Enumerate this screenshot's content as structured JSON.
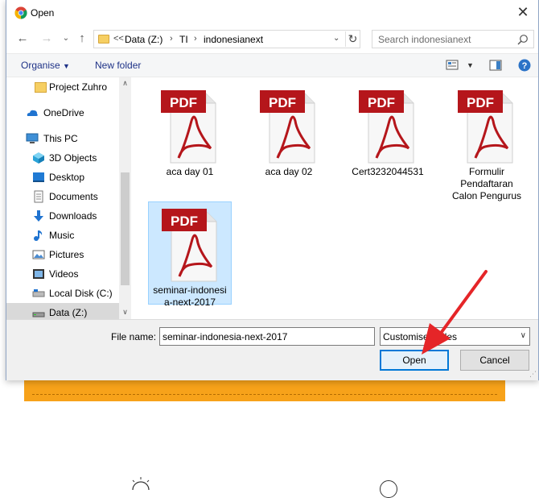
{
  "window": {
    "title": "Open"
  },
  "nav": {
    "breadcrumb": [
      "Data (Z:)",
      "TI",
      "indonesianext"
    ],
    "overflow": "<<",
    "search_placeholder": "Search indonesianext"
  },
  "toolbar": {
    "organise": "Organise",
    "new_folder": "New folder"
  },
  "sidebar": {
    "items": [
      {
        "label": "Project Zuhro",
        "icon": "folder-icon"
      },
      {
        "label": "OneDrive",
        "icon": "cloud-icon"
      },
      {
        "label": "This PC",
        "icon": "computer-icon"
      },
      {
        "label": "3D Objects",
        "icon": "cube-icon"
      },
      {
        "label": "Desktop",
        "icon": "desktop-icon"
      },
      {
        "label": "Documents",
        "icon": "document-icon"
      },
      {
        "label": "Downloads",
        "icon": "download-icon"
      },
      {
        "label": "Music",
        "icon": "music-icon"
      },
      {
        "label": "Pictures",
        "icon": "pictures-icon"
      },
      {
        "label": "Videos",
        "icon": "video-icon"
      },
      {
        "label": "Local Disk (C:)",
        "icon": "drive-icon"
      },
      {
        "label": "Data (Z:)",
        "icon": "drive-icon",
        "selected": true
      }
    ]
  },
  "files": [
    {
      "name": "aca day 01",
      "icon": "pdf-icon"
    },
    {
      "name": "aca day 02",
      "icon": "pdf-icon"
    },
    {
      "name": "Cert3232044531",
      "icon": "pdf-icon"
    },
    {
      "name": "Formulir Pendaftaran Calon Pengurus",
      "icon": "pdf-icon"
    },
    {
      "name": "seminar-indonesia-next-2017",
      "icon": "pdf-icon",
      "selected": true
    }
  ],
  "file_names_display": {
    "f4_line1": "Formulir",
    "f4_line2": "Pendaftaran",
    "f4_line3": "Calon Pengurus",
    "f5_line1": "seminar-indonesi",
    "f5_line2": "a-next-2017"
  },
  "pdf_badge": "PDF",
  "bottom": {
    "file_name_label": "File name:",
    "file_name_value": "seminar-indonesia-next-2017",
    "file_type": "Customised Files",
    "open": "Open",
    "cancel": "Cancel"
  },
  "colors": {
    "accent": "#0078d7",
    "pdf_red": "#b5161b",
    "annotation_arrow": "#e52528",
    "page_orange": "#f7a21a"
  }
}
